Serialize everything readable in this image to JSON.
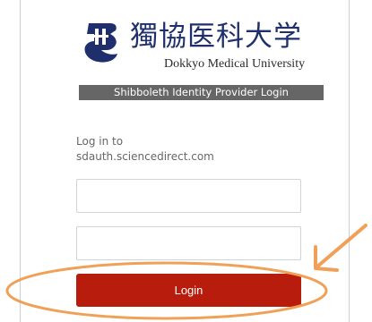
{
  "brand": {
    "name_jp": "獨協医科大学",
    "name_en": "Dokkyo Medical University",
    "logo_color": "#1e2f6b"
  },
  "banner": {
    "text": "Shibboleth Identity Provider Login",
    "background": "#666666"
  },
  "login": {
    "prompt": "Log in to",
    "service_host": "sdauth.sciencedirect.com",
    "username_placeholder": "",
    "password_placeholder": "",
    "button_label": "Login",
    "button_color": "#b71c0c"
  },
  "annotation": {
    "color": "#f0a057",
    "icons": [
      "ellipse-highlight",
      "arrow-pointer"
    ]
  }
}
